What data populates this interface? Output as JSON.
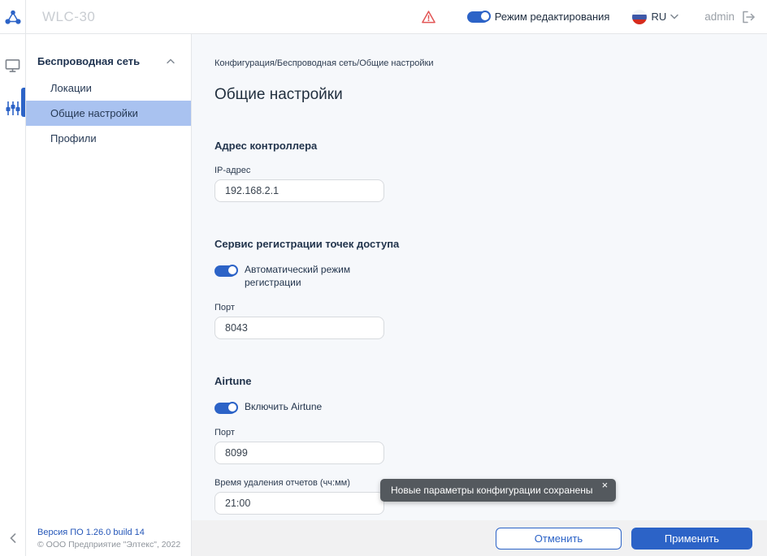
{
  "header": {
    "title": "WLC-30",
    "edit_mode": {
      "label": "Режим редактирования",
      "on": true
    },
    "language": {
      "code": "RU",
      "flag": "flag-russia"
    },
    "user": {
      "name": "admin"
    },
    "icons": {
      "logo": "network-nodes",
      "warning": "warning-triangle",
      "logout": "logout-arrow",
      "lang_chevron": "chevron-down"
    }
  },
  "rail": {
    "icons": [
      {
        "name": "monitor-icon",
        "active": false
      },
      {
        "name": "sliders-icon",
        "active": true
      }
    ],
    "collapse_icon": "chevron-left"
  },
  "sidebar": {
    "group": {
      "label": "Беспроводная сеть",
      "expanded": true,
      "chevron": "chevron-up"
    },
    "items": [
      {
        "label": "Локации",
        "selected": false
      },
      {
        "label": "Общие настройки",
        "selected": true
      },
      {
        "label": "Профили",
        "selected": false
      }
    ],
    "footer": {
      "version": "Версия ПО 1.26.0 build 14",
      "copyright": "© ООО Предприятие \"Элтекс\", 2022"
    }
  },
  "main": {
    "breadcrumb": "Конфигурация/Беспроводная сеть/Общие настройки",
    "title": "Общие настройки",
    "sections": [
      {
        "title": "Адрес контроллера",
        "fields": [
          {
            "label": "IP-адрес",
            "value": "192.168.2.1"
          }
        ]
      },
      {
        "title": "Сервис регистрации точек доступа",
        "toggle": {
          "label": "Автоматический режим регистрации",
          "on": true
        },
        "fields": [
          {
            "label": "Порт",
            "value": "8043"
          }
        ]
      },
      {
        "title": "Airtune",
        "toggle": {
          "label": "Включить Airtune",
          "on": true
        },
        "fields": [
          {
            "label": "Порт",
            "value": "8099"
          },
          {
            "label": "Время удаления отчетов (чч:мм)",
            "value": "21:00"
          }
        ]
      }
    ]
  },
  "toast": {
    "message": "Новые параметры конфигурации сохранены",
    "close_icon": "×"
  },
  "action_bar": {
    "cancel_label": "Отменить",
    "apply_label": "Применить"
  },
  "colors": {
    "primary": "#2c63c7",
    "selected_item_bg": "#a9c2f0",
    "toast_bg": "#54595e",
    "warning": "#e25555",
    "content_bg": "#f6f8fb",
    "action_bar_bg": "#f1f1f2",
    "text": "#243850"
  }
}
